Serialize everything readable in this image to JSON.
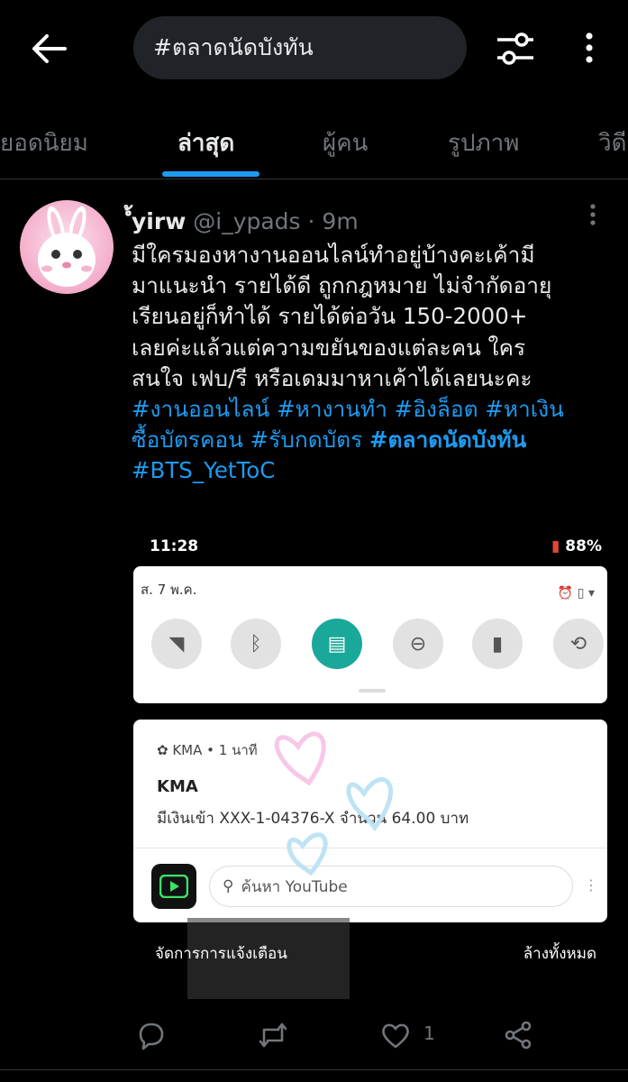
{
  "search": {
    "query": "#ตลาดนัดบังทัน"
  },
  "tabs": [
    {
      "label": "ยอดนิยม"
    },
    {
      "label": "ล่าสุด",
      "active": true
    },
    {
      "label": "ผู้คน"
    },
    {
      "label": "รูปภาพ"
    },
    {
      "label": "วิดี"
    }
  ],
  "tweet": {
    "display_name": "ํ้yirw",
    "handle": "@i_ypads",
    "time": "· 9m",
    "lines": [
      "มีใครมองหางานออนไลน์ทำอยู่บ้างคะเค้ามี",
      "มาแนะนำ รายได้ดี ถูกกฎหมาย ไม่จำกัดอายุ",
      "เรียนอยู่ก็ทำได้  รายได้ต่อวัน 150-2000+",
      "เลยค่ะแล้วแต่ความขยันของแต่ละคน ใคร",
      "สนใจ เฟบ/รี หรือเดมมาหาเค้าได้เลยนะคะ"
    ],
    "hashtags": {
      "t1": "#งานออนไลน์",
      "t2": "#หางานทำ",
      "t3": "#อิงล็อต",
      "t4": "#หาเงิน",
      "t5": "ซื้อบัตรคอน",
      "t6": "#รับกดบัตร",
      "t7": "#ตลาดนัดบังทัน",
      "t8": "#BTS_YetToC"
    },
    "likes": "1"
  },
  "media": {
    "status_time": "11:28",
    "battery": "88%",
    "date": "ส. 7 พ.ค.",
    "notif_app": "KMA • 1 นาที",
    "notif_title": "KMA",
    "notif_body": "มีเงินเข้า XXX-1-04376-X จำนวน 64.00 บาท",
    "yt_placeholder": "ค้นหา YouTube",
    "manage": "จัดการการแจ้งเตือน",
    "clear_all": "ล้างทั้งหมด"
  },
  "colors": {
    "accent": "#1d9bf0",
    "background": "#000000",
    "muted": "#71767b"
  },
  "icons": [
    "back-arrow-icon",
    "filter-sliders-icon",
    "more-vertical-icon",
    "reply-icon",
    "retweet-icon",
    "like-icon",
    "share-icon"
  ]
}
